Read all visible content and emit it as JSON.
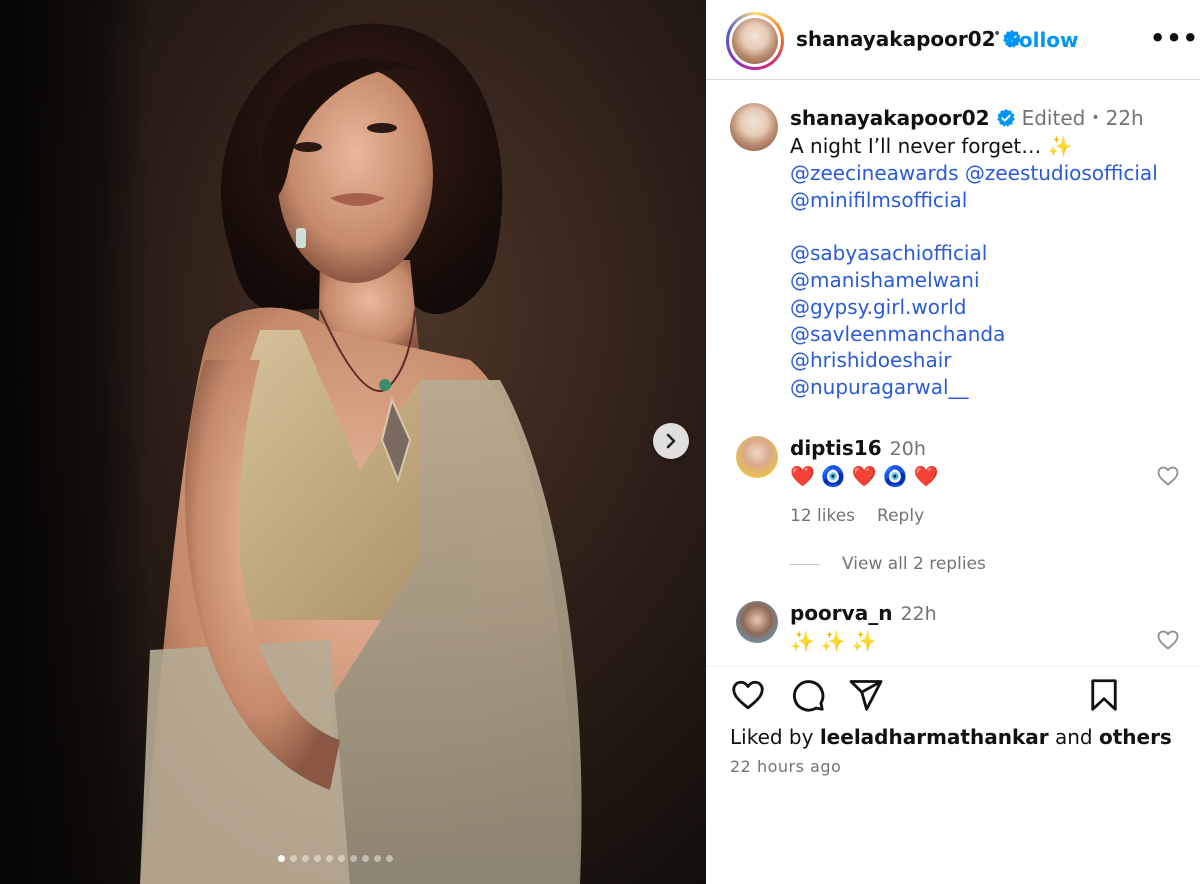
{
  "post": {
    "username": "shanayakapoor02",
    "follow_label": "Follow",
    "separator": "•",
    "more_label": "•••",
    "carousel": {
      "slide_count": 10,
      "active_index": 0
    }
  },
  "caption": {
    "username": "shanayakapoor02",
    "edited": "Edited",
    "separator": "•",
    "time": "22h",
    "text": "A night I’ll never forget… ✨",
    "mentions_1": [
      "@zeecineawards @zeestudiosofficial",
      "@minifilmsofficial"
    ],
    "mentions_2": [
      "@sabyasachiofficial",
      "@manishamelwani",
      "@gypsy.girl.world",
      "@savleenmanchanda",
      "@hrishidoeshair",
      "@nupuragarwal__"
    ]
  },
  "comments": [
    {
      "username": "diptis16",
      "time": "20h",
      "body": "❤️🧿❤️🧿❤️",
      "likes": "12 likes",
      "reply_label": "Reply",
      "view_replies": "View all 2 replies"
    },
    {
      "username": "poorva_n",
      "time": "22h",
      "body": "✨✨✨"
    }
  ],
  "footer": {
    "liked_by_prefix": "Liked by",
    "liked_by_user": "leeladharmathankar",
    "liked_by_and": "and",
    "liked_by_others": "others",
    "time_ago": "22 hours ago"
  },
  "colors": {
    "accent": "#0095f6",
    "mention": "#2a5bd7",
    "muted": "#737373"
  }
}
